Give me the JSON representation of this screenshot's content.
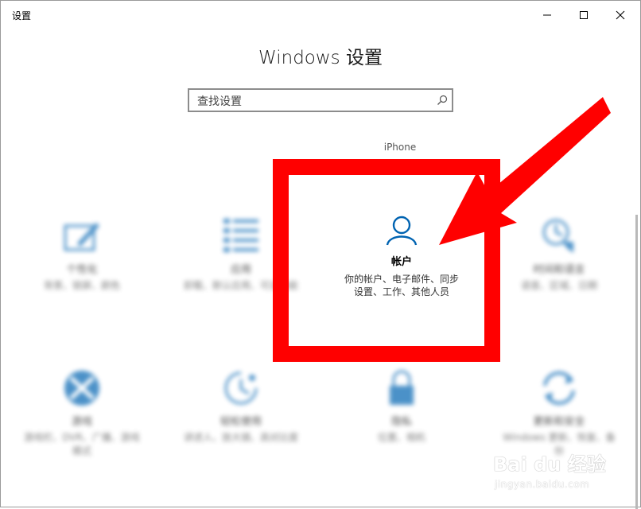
{
  "window": {
    "title": "设置",
    "controls": {
      "minimize": "minimize",
      "maximize": "maximize",
      "close": "close"
    }
  },
  "page": {
    "title": "Windows 设置"
  },
  "search": {
    "placeholder": "查找设置",
    "value": ""
  },
  "peek_label": "iPhone",
  "tiles": [
    {
      "name": "个性化",
      "desc": "背景、锁屏、颜色",
      "icon": "personalization-icon"
    },
    {
      "name": "应用",
      "desc": "卸载、默认应用、可选功能",
      "icon": "apps-icon"
    },
    {
      "name": "帐户",
      "desc": "你的帐户、电子邮件、同步设置、工作、其他人员",
      "desc_line1": "你的帐户、电子邮件、同步",
      "desc_line2": "设置、工作、其他人员",
      "icon": "account-icon"
    },
    {
      "name": "时间和语言",
      "desc": "语音、区域、日期",
      "icon": "time-language-icon"
    },
    {
      "name": "游戏",
      "desc": "游戏栏、DVR、广播、游戏模式",
      "icon": "gaming-icon"
    },
    {
      "name": "轻松使用",
      "desc": "讲述人、放大镜、高对比度",
      "icon": "ease-of-access-icon"
    },
    {
      "name": "隐私",
      "desc": "位置、相机",
      "icon": "privacy-icon"
    },
    {
      "name": "更新和安全",
      "desc": "Windows 更新、恢复、备份",
      "icon": "update-security-icon"
    }
  ],
  "colors": {
    "accent": "#0063b1",
    "highlight": "#ff0000"
  },
  "watermark": {
    "brand": "Bai du 经验",
    "sub": "jingyan.baidu.com"
  }
}
